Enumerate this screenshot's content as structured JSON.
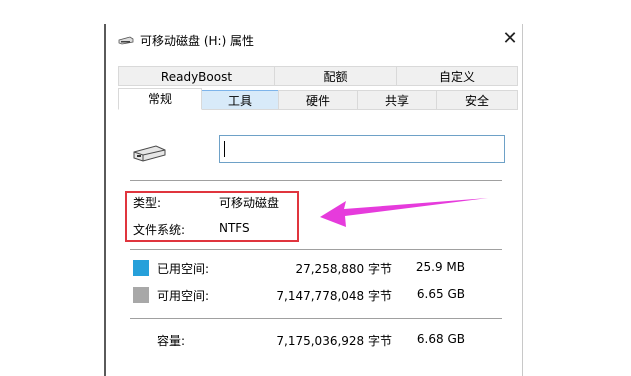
{
  "window": {
    "title": "可移动磁盘 (H:) 属性",
    "close_glyph": "✕"
  },
  "tabs_row1": [
    {
      "label": "ReadyBoost"
    },
    {
      "label": "配额"
    },
    {
      "label": "自定义"
    }
  ],
  "tabs_row2": [
    {
      "label": "常规",
      "state": "active"
    },
    {
      "label": "工具",
      "state": "hover"
    },
    {
      "label": "硬件"
    },
    {
      "label": "共享"
    },
    {
      "label": "安全"
    }
  ],
  "general": {
    "drive_icon": "usb-drive-icon",
    "name_value": "",
    "type_label": "类型:",
    "type_value": "可移动磁盘",
    "fs_label": "文件系统:",
    "fs_value": "NTFS",
    "used_label": "已用空间:",
    "used_bytes": "27,258,880 字节",
    "used_human": "25.9 MB",
    "used_color": "#26a0da",
    "free_label": "可用空间:",
    "free_bytes": "7,147,778,048 字节",
    "free_human": "6.65 GB",
    "free_color": "#a8a8a8",
    "capacity_label": "容量:",
    "capacity_bytes": "7,175,036,928 字节",
    "capacity_human": "6.68 GB"
  },
  "annotation": {
    "box_color": "#e0353e",
    "arrow_color": "#e63bdc"
  }
}
